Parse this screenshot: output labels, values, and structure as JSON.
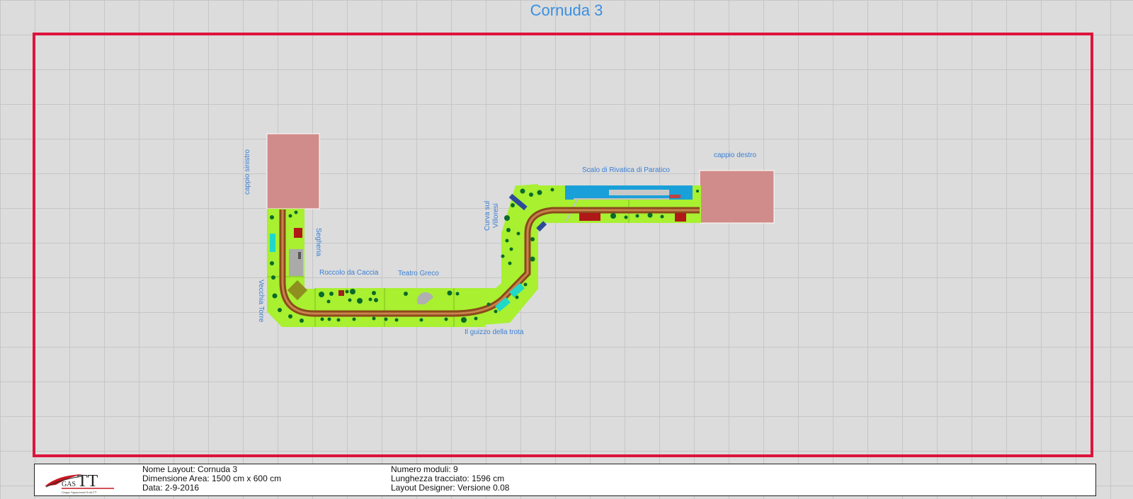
{
  "title": "Cornuda 3",
  "labels": {
    "cappio_sinistro": "cappio sinistro",
    "segheria": "Segheria",
    "vecchia_torre": "Vecchia Torre",
    "roccolo": "Roccolo da Caccia",
    "teatro": "Teatro Greco",
    "guizzo": "Il guizzo della trota",
    "curva_line1": "Curva sul",
    "curva_line2": "Villoresi",
    "scalo": "Scalo di Rivatica di Paratico",
    "cappio_destro": "cappio destro"
  },
  "info": {
    "nome_layout": "Nome Layout: Cornuda 3",
    "dimensione": "Dimensione Area: 1500 cm x 600 cm",
    "data": "Data: 2-9-2016",
    "numero_moduli": "Numero moduli: 9",
    "lunghezza": "Lunghezza tracciato: 1596 cm",
    "designer": "Layout Designer: Versione 0.08"
  },
  "logo": {
    "main": "TT",
    "prefix": "GAS",
    "subtitle": "Gruppo Appassionati Scala TT"
  },
  "colors": {
    "background": "#dcdcdc",
    "grid": "#c6c6c6",
    "border": "#dc143c",
    "title": "#3a8fe0",
    "module_green": "#a8f030",
    "loop_pink": "#d08c8a",
    "track_brown": "#8b4a1c",
    "tree": "#0a6a2a",
    "water": "#1aa0d8",
    "cyan": "#20d8c8"
  }
}
